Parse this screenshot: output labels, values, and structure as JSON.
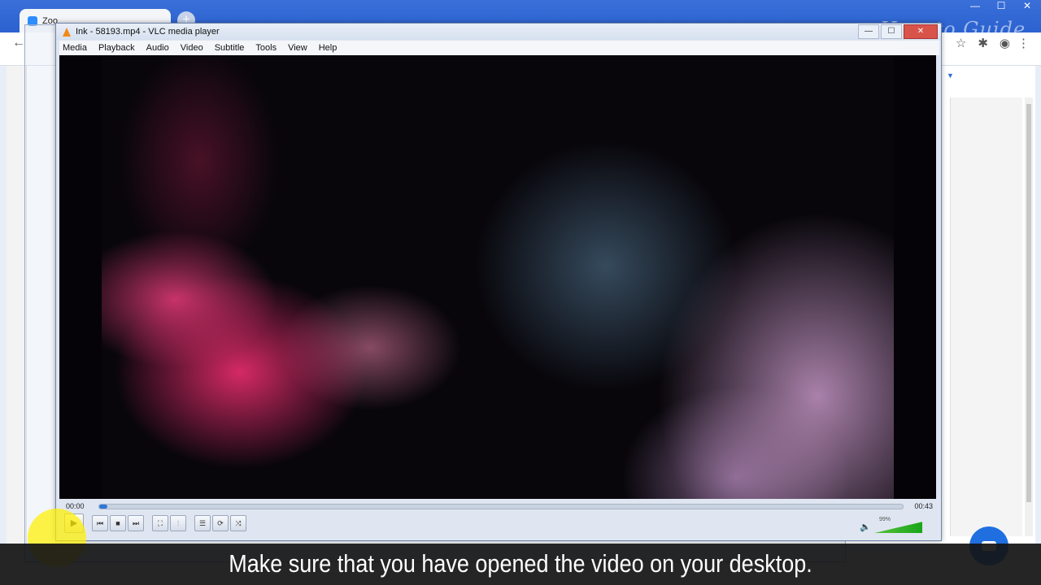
{
  "browser": {
    "tab_label": "Zoo",
    "new_tab": "+",
    "back": "←",
    "window_controls": [
      "—",
      "☐",
      "✕"
    ],
    "toolbar_icons": [
      "star-icon",
      "puzzle-icon",
      "account-icon"
    ],
    "menu": "⋮"
  },
  "watermark": "How to Guide",
  "vlc": {
    "title": "Ink - 58193.mp4 - VLC media player",
    "window_controls": [
      "—",
      "☐",
      "✕"
    ],
    "menu": [
      "Media",
      "Playback",
      "Audio",
      "Video",
      "Subtitle",
      "Tools",
      "View",
      "Help"
    ],
    "time_current": "00:00",
    "time_total": "00:43",
    "progress_fraction": 0.01,
    "volume_label": "99%",
    "volume_fraction": 0.99,
    "buttons": {
      "play": "▶",
      "prev": "⏮",
      "stop": "■",
      "next": "⏭",
      "fullscreen": "⛶",
      "extended": "⫶",
      "playlist": "☰",
      "loop": "⟳",
      "shuffle": "⤨"
    }
  },
  "caption": "Make sure that you have opened the video on your desktop.",
  "colors": {
    "accent": "#2e78d6",
    "vlc_orange": "#f28a1a",
    "highlight": "#fff000"
  }
}
